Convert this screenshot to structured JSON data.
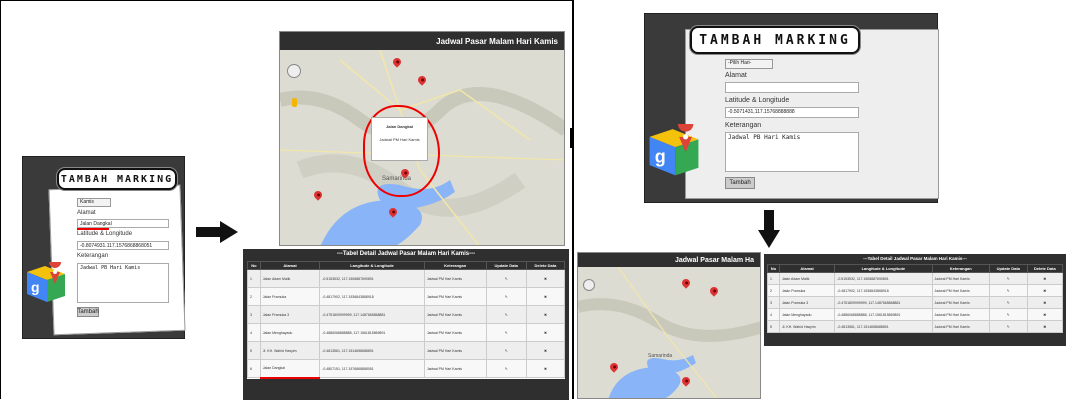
{
  "form_left": {
    "title": "TAMBAH MARKING",
    "select_value": "Kamis",
    "alamat_label": "Alamat",
    "alamat_value": "Jalan Dangkal",
    "latlng_label": "Latitude & Longitude",
    "latlng_value": "-0.8074931.117.1576868868051",
    "keterangan_label": "Keterangan",
    "keterangan_value": "Jadwal PB Hari Kamis",
    "submit_label": "Tambah"
  },
  "form_right": {
    "title": "TAMBAH MARKING",
    "select_value": "-Pilih Hari-",
    "alamat_label": "Alamat",
    "alamat_value": "",
    "latlng_label": "Latitude & Longitude",
    "latlng_value": "-0.5071431,117.15768888888",
    "keterangan_label": "Keterangan",
    "keterangan_value": "Jadwal PB Hari Kamis",
    "submit_label": "Tambah"
  },
  "map_left": {
    "header": "Jadwal Pasar Malam Hari Kamis",
    "popup_title": "Jalan Dangkal",
    "popup_body": "Jadwal PM Hari Kamis",
    "city_label": "Samarinda"
  },
  "map_right": {
    "header": "Jadwal Pasar Malam Ha",
    "city_label": "Samarinda"
  },
  "table_left": {
    "title": "---Tabel Detail Jadwal Pasar Malam Hari Kamis---",
    "headers": [
      "No",
      "Alamat",
      "Langitude & Longitude",
      "Keterangan",
      "Update Data",
      "Delete Data"
    ],
    "rows": [
      {
        "no": "1",
        "alamat": "Jalan Adam Malik",
        "latlng": "-0.5153532, 117.1506887690891",
        "ket": "Jadwal PM Hari Kamis"
      },
      {
        "no": "2",
        "alamat": "Jalan Pramuka",
        "latlng": "-0.4817902, 117.1536843868918",
        "ket": "Jadwal PM Hari Kamis"
      },
      {
        "no": "3",
        "alamat": "Jalan Pramuka 3",
        "latlng": "-0.4751809999999, 117.1487665868881",
        "ket": "Jadwal PM Hari Kamis"
      },
      {
        "no": "4",
        "alamat": "Jalan Menghayadu",
        "latlng": "-0.4886068888888, 117.1561815869891",
        "ket": "Jadwal PM Hari Kamis"
      },
      {
        "no": "5",
        "alamat": "Jl. KH. Wahid Hasyim",
        "latlng": "-0.4813561, 117.1514658688891",
        "ket": "Jadwal PM Hari Kamis"
      },
      {
        "no": "6",
        "alamat": "Jalan Dangkal",
        "latlng": "-0.4807151, 117.1576868868051",
        "ket": "Jadwal PM Hari Kamis"
      }
    ],
    "edit_icon": "pencil",
    "delete_icon": "trash"
  },
  "table_right": {
    "title": "---Tabel Detail Jadwal Pasar Malam Hari Kamis---",
    "headers": [
      "No",
      "Alamat",
      "Langitude & Longitude",
      "Keterangan",
      "Update Data",
      "Delete Data"
    ],
    "rows": [
      {
        "no": "1",
        "alamat": "Jalan Adam Malik",
        "latlng": "-0.5153532, 117.1506887690891",
        "ket": "Jadwal PM Hari Kamis"
      },
      {
        "no": "2",
        "alamat": "Jalan Pramuka",
        "latlng": "-0.4817902, 117.1536843868918",
        "ket": "Jadwal PM Hari Kamis"
      },
      {
        "no": "3",
        "alamat": "Jalan Pramuka 3",
        "latlng": "-0.4751809999999, 117.1487665868881",
        "ket": "Jadwal PM Hari Kamis"
      },
      {
        "no": "4",
        "alamat": "Jalan Menghayadu",
        "latlng": "-0.4886068888888, 117.1561815869891",
        "ket": "Jadwal PM Hari Kamis"
      },
      {
        "no": "5",
        "alamat": "Jl. KH. Wahid Hasyim",
        "latlng": "-0.4813561, 117.1514658688891",
        "ket": "Jadwal PM Hari Kamis"
      }
    ]
  },
  "colors": {
    "dark_panel": "#3a3a3a",
    "highlight_red": "#e00000",
    "water": "#8ab4f8",
    "pin": "#d33333"
  }
}
